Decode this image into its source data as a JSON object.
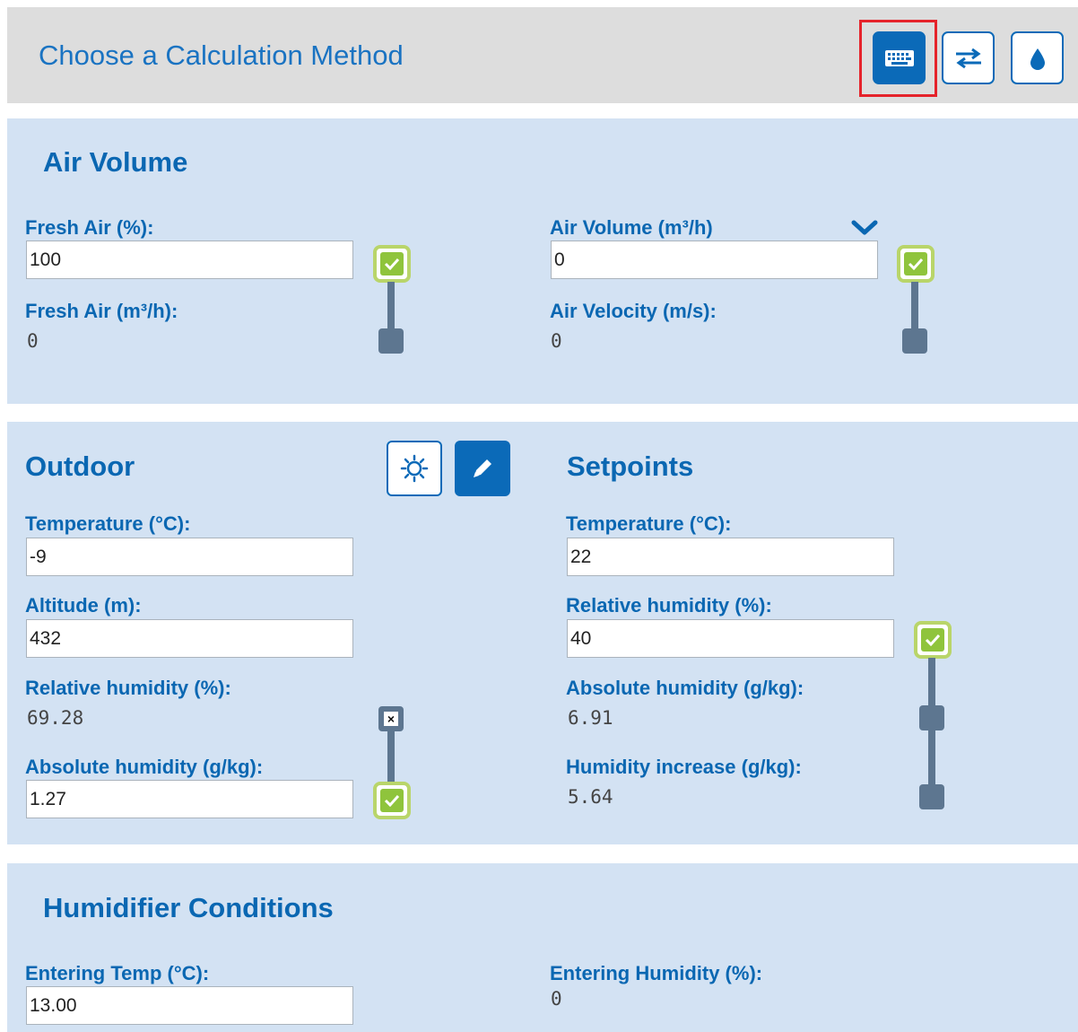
{
  "header": {
    "title": "Choose a Calculation Method",
    "buttons": [
      "keyboard-icon",
      "swap-arrows-icon",
      "water-drop-icon"
    ]
  },
  "air_volume": {
    "title": "Air Volume",
    "fresh_air_pct_label": "Fresh Air (%):",
    "fresh_air_pct_value": "100",
    "fresh_air_m3h_label": "Fresh Air (m³/h):",
    "fresh_air_m3h_value": "0",
    "air_volume_label": "Air Volume (m³/h)",
    "air_volume_value": "0",
    "air_velocity_label": "Air Velocity (m/s):",
    "air_velocity_value": "0"
  },
  "outdoor": {
    "title": "Outdoor",
    "temperature_label": "Temperature (°C):",
    "temperature_value": "-9",
    "altitude_label": "Altitude (m):",
    "altitude_value": "432",
    "rh_label": "Relative humidity (%):",
    "rh_value": "69.28",
    "abs_label": "Absolute humidity (g/kg):",
    "abs_value": "1.27"
  },
  "setpoints": {
    "title": "Setpoints",
    "temperature_label": "Temperature (°C):",
    "temperature_value": "22",
    "rh_label": "Relative humidity (%):",
    "rh_value": "40",
    "abs_label": "Absolute humidity (g/kg):",
    "abs_value": "6.91",
    "increase_label": "Humidity increase (g/kg):",
    "increase_value": "5.64"
  },
  "humidifier": {
    "title": "Humidifier Conditions",
    "entering_temp_label": "Entering Temp (°C):",
    "entering_temp_value": "13.00",
    "entering_humidity_label": "Entering Humidity (%):",
    "entering_humidity_value": "0"
  },
  "colors": {
    "accent": "#0b6ab8",
    "panel": "#d3e2f3",
    "check_green": "#8fc43c",
    "highlight_red": "#e5232b"
  }
}
